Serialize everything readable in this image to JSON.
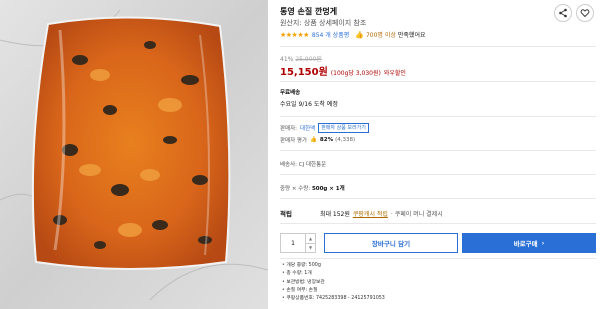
{
  "product": {
    "title": "통영 손질 깐멍게",
    "origin": "원산지: 상품 상세페이지 참조",
    "rating_stars": "★★★★★",
    "review_count": "854 개 상품평",
    "satisfaction_count": "700명 이상",
    "satisfaction_text": "만족했어요"
  },
  "price": {
    "discount": "41%",
    "original": "25,900원",
    "sale": "15,150원",
    "unit_price": "(100g당 3,030원)",
    "wow_label": "와우할인"
  },
  "shipping": {
    "label": "무료배송",
    "arrival": "수요일 9/16 도착 예정"
  },
  "seller": {
    "label": "판매자:",
    "name": "대한액",
    "other_products": "판매자 상품 보러가기",
    "rating_label": "판매자 평가",
    "rating_percent": "82%",
    "rating_count": "(4,338)"
  },
  "delivery_company": "배송사: CJ 대한통운",
  "option": {
    "label": "중량 × 수량:",
    "value": "500g × 1개"
  },
  "reward": {
    "label": "적립",
    "max": "최대 152원",
    "cash": "쿠팡캐시 적립",
    "pay_note": "· 쿠페이 머니 결제시"
  },
  "purchase": {
    "quantity": "1",
    "cart_label": "장바구니 담기",
    "buy_label": "바로구매",
    "buy_chevron": "›"
  },
  "details": [
    "개당 중량: 500g",
    "총 수량: 1개",
    "보관방법: 냉장보관",
    "손질 여부: 손질",
    "쿠팡상품번호: 7425283398 - 24125791053"
  ],
  "colors": {
    "accent_blue": "#2a6fd6",
    "price_red": "#ae0000",
    "star_orange": "#f5a000"
  },
  "icons": [
    "share-icon",
    "heart-icon",
    "thumbs-up-icon",
    "chevron-right-icon",
    "up-arrow-icon",
    "down-arrow-icon"
  ]
}
